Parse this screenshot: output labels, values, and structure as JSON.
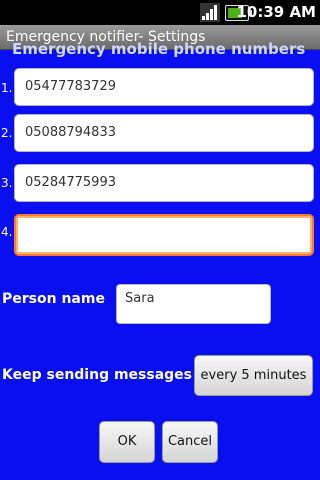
{
  "status_bar": {
    "time": "10:39 AM",
    "icons": [
      "signal-icon",
      "battery-icon"
    ]
  },
  "app": {
    "title": "Emergency notifier- Settings"
  },
  "section": {
    "header": "Emergency mobile phone numbers"
  },
  "phones": [
    {
      "index": "1.",
      "value": "05477783729"
    },
    {
      "index": "2.",
      "value": "05088794833"
    },
    {
      "index": "3.",
      "value": "05284775993"
    },
    {
      "index": "4.",
      "value": ""
    }
  ],
  "person": {
    "label": "Person name",
    "value": "Sara"
  },
  "sending": {
    "label": "Keep sending messages",
    "value": "every 5 minutes"
  },
  "buttons": {
    "ok": "OK",
    "cancel": "Cancel"
  },
  "colors": {
    "background": "#0a0ff0",
    "focus": "#ff7a2a"
  }
}
